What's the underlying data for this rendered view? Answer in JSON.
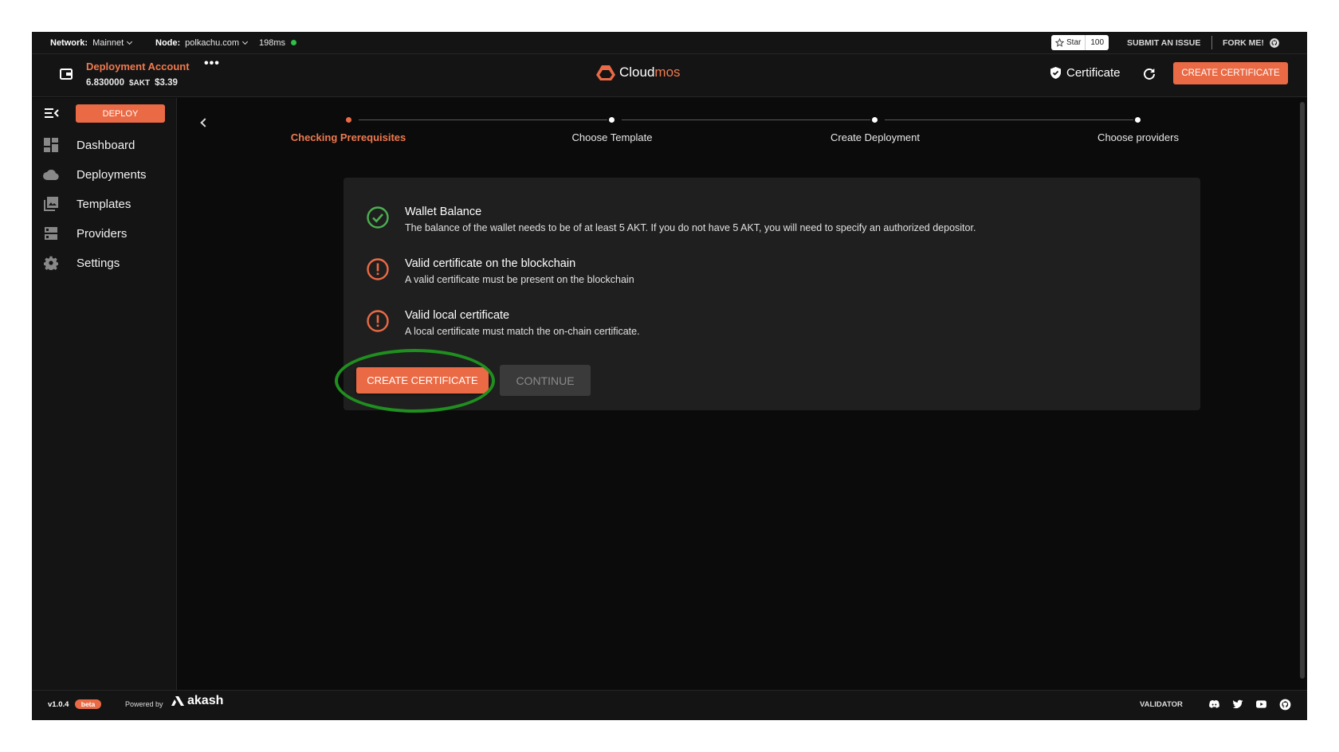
{
  "topbar": {
    "network_label": "Network:",
    "network_value": "Mainnet",
    "node_label": "Node:",
    "node_value": "polkachu.com",
    "latency": "198ms",
    "star_label": "Star",
    "star_count": "100",
    "submit_issue": "SUBMIT AN ISSUE",
    "fork_me": "FORK ME!"
  },
  "header": {
    "account_name": "Deployment Account",
    "account_more": "•••",
    "balance": "6.830000",
    "balance_unit": "$AKT",
    "balance_usd": "$3.39",
    "brand_part1": "Cloud",
    "brand_part2": "mos",
    "certificate_label": "Certificate",
    "create_certificate": "CREATE CERTIFICATE"
  },
  "sidebar": {
    "deploy_label": "DEPLOY",
    "items": [
      {
        "label": "Dashboard",
        "icon": "dashboard-icon"
      },
      {
        "label": "Deployments",
        "icon": "cloud-icon"
      },
      {
        "label": "Templates",
        "icon": "templates-icon"
      },
      {
        "label": "Providers",
        "icon": "providers-icon"
      },
      {
        "label": "Settings",
        "icon": "gear-icon"
      }
    ]
  },
  "stepper": {
    "steps": [
      {
        "label": "Checking Prerequisites",
        "active": true
      },
      {
        "label": "Choose Template",
        "active": false
      },
      {
        "label": "Create Deployment",
        "active": false
      },
      {
        "label": "Choose providers",
        "active": false
      }
    ]
  },
  "prerequisites": {
    "items": [
      {
        "title": "Wallet Balance",
        "description": "The balance of the wallet needs to be of at least 5 AKT. If you do not have 5 AKT, you will need to specify an authorized depositor.",
        "status": "ok"
      },
      {
        "title": "Valid certificate on the blockchain",
        "description": "A valid certificate must be present on the blockchain",
        "status": "warning"
      },
      {
        "title": "Valid local certificate",
        "description": "A local certificate must match the on-chain certificate.",
        "status": "warning"
      }
    ],
    "create_certificate": "CREATE CERTIFICATE",
    "continue": "CONTINUE"
  },
  "footer": {
    "version": "v1.0.4",
    "beta": "beta",
    "powered_by": "Powered by",
    "akash": "akash",
    "validator": "VALIDATOR"
  },
  "colors": {
    "accent": "#ea6a45",
    "success": "#4caf50",
    "highlight": "#1f8f1f",
    "background": "#0b0b0b",
    "panel": "#1f1f1f"
  }
}
